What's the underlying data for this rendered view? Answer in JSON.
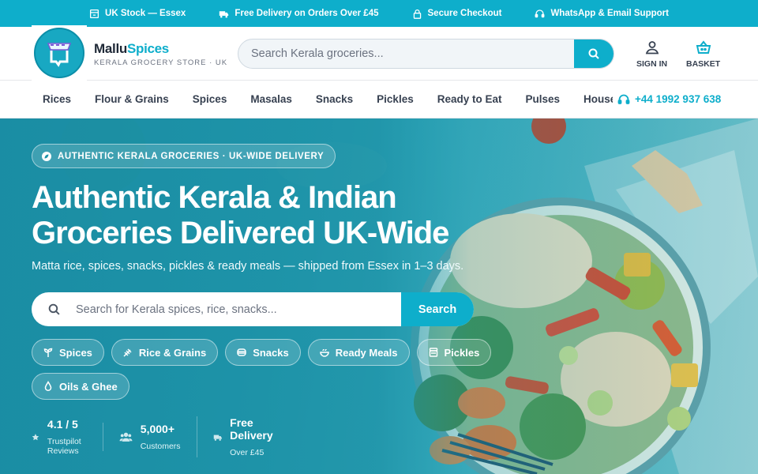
{
  "topbar": {
    "items": [
      {
        "icon": "store-icon",
        "label": "UK Stock — Essex"
      },
      {
        "icon": "truck-icon",
        "label": "Free Delivery on Orders Over £45"
      },
      {
        "icon": "lock-icon",
        "label": "Secure Checkout"
      },
      {
        "icon": "headset-icon",
        "label": "WhatsApp & Email Support"
      }
    ]
  },
  "header": {
    "brand_part1": "Mallu",
    "brand_part2": "Spices",
    "tagline": "KERALA GROCERY STORE · UK",
    "search_placeholder": "Search Kerala groceries...",
    "sign_in_label": "SIGN IN",
    "basket_label": "BASKET"
  },
  "nav": {
    "items": [
      "Rices",
      "Flour & Grains",
      "Spices",
      "Masalas",
      "Snacks",
      "Pickles",
      "Ready to Eat",
      "Pulses",
      "Household"
    ],
    "phone": "+44 1992 937 638"
  },
  "hero": {
    "badge": "AUTHENTIC KERALA GROCERIES · UK-WIDE DELIVERY",
    "title_line1": "Authentic Kerala & Indian",
    "title_line2": "Groceries Delivered UK-Wide",
    "subtitle": "Matta rice, spices, snacks, pickles & ready meals — shipped from Essex in 1–3 days.",
    "search_placeholder": "Search for Kerala spices, rice, snacks...",
    "search_button": "Search",
    "chips": [
      {
        "icon": "sprout-icon",
        "label": "Spices"
      },
      {
        "icon": "wheat-icon",
        "label": "Rice & Grains"
      },
      {
        "icon": "cookie-icon",
        "label": "Snacks"
      },
      {
        "icon": "bowl-icon",
        "label": "Ready Meals"
      },
      {
        "icon": "jar-icon",
        "label": "Pickles"
      },
      {
        "icon": "drop-icon",
        "label": "Oils & Ghee"
      }
    ],
    "stats": [
      {
        "icon": "star-icon",
        "value": "4.1 / 5",
        "label": "Trustpilot Reviews"
      },
      {
        "icon": "users-icon",
        "value": "5,000+",
        "label": "Customers"
      },
      {
        "icon": "truck-icon",
        "value": "Free Delivery",
        "label": "Over £45"
      }
    ]
  },
  "colors": {
    "accent": "#0eaecb",
    "hero_bg": "#2399ad"
  }
}
